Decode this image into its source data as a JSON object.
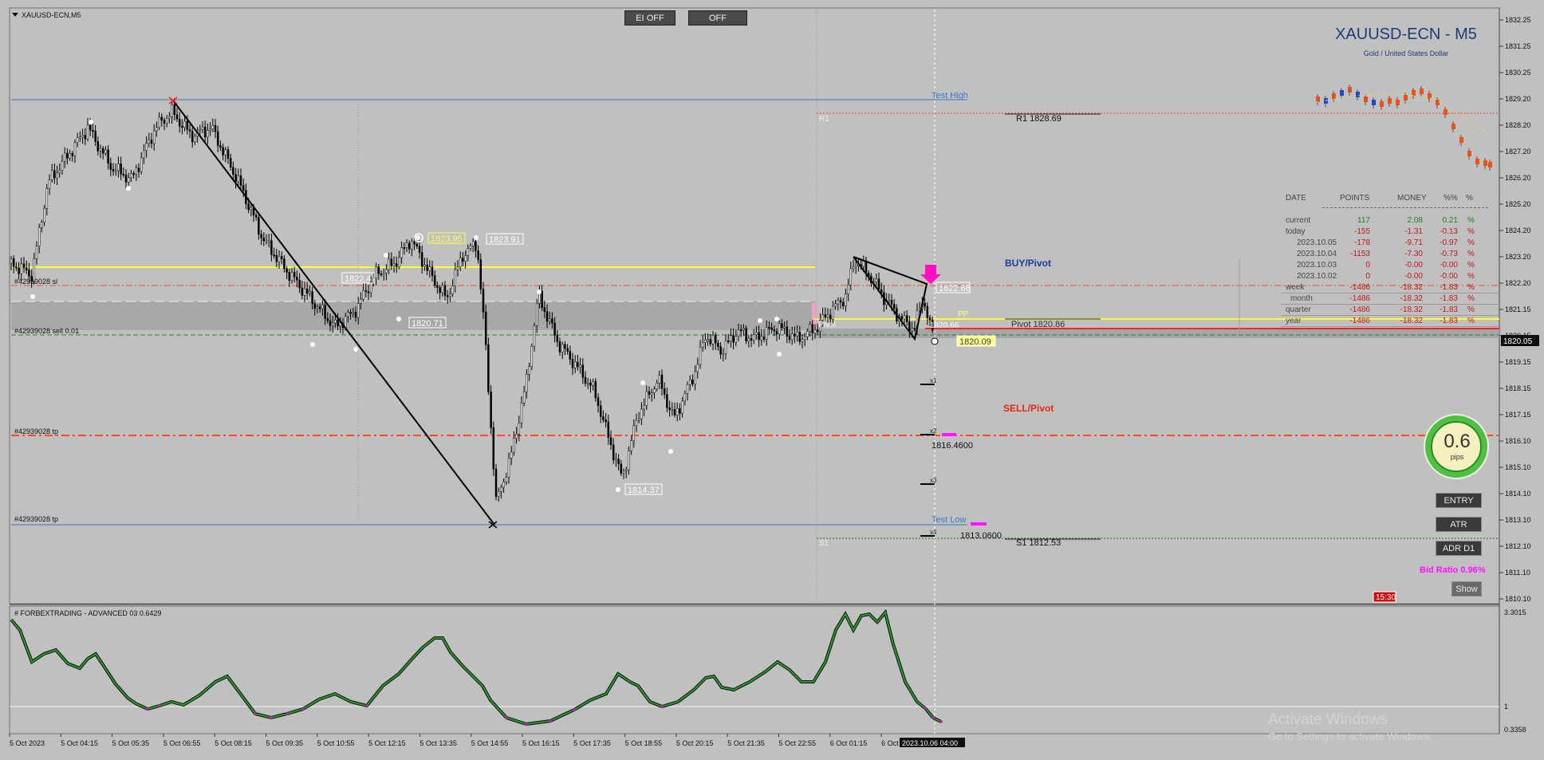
{
  "window": {
    "title": "XAUUSD-ECN,M5"
  },
  "symbol": {
    "name": "XAUUSD-ECN - M5",
    "description": "Gold / United States Dollar"
  },
  "buttons": {
    "ei_off": "EI OFF",
    "off": "OFF",
    "entry": "ENTRY",
    "atr": "ATR",
    "adr_d1": "ADR D1",
    "show": "Show"
  },
  "price_axis": {
    "ticks": [
      "1832.25",
      "1831.25",
      "1830.25",
      "1829.20",
      "1828.20",
      "1827.20",
      "1826.20",
      "1825.20",
      "1824.20",
      "1823.20",
      "1822.20",
      "1821.15",
      "1820.15",
      "1819.15",
      "1818.15",
      "1817.15",
      "1816.10",
      "1815.10",
      "1814.10",
      "1813.10",
      "1812.10",
      "1811.10",
      "1810.10"
    ],
    "current_price": "1820.05"
  },
  "indicator": {
    "title": "# FORBEXTRADING - ADVANCED 03 0.6429",
    "ticks": [
      "3.3015",
      "1",
      "0.3358"
    ]
  },
  "time_axis": [
    "5 Oct 2023",
    "5 Oct 04:15",
    "5 Oct 05:35",
    "5 Oct 06:55",
    "5 Oct 08:15",
    "5 Oct 09:35",
    "5 Oct 10:55",
    "5 Oct 12:15",
    "5 Oct 13:35",
    "5 Oct 14:55",
    "5 Oct 16:15",
    "5 Oct 17:35",
    "5 Oct 18:55",
    "5 Oct 20:15",
    "5 Oct 21:35",
    "5 Oct 22:55",
    "6 Oct 01:15",
    "6 Oct"
  ],
  "crosshair_time": "2023.10.06 04:00",
  "labels": {
    "test_high": "Test High",
    "test_low": "Test Low",
    "r1_short": "R1",
    "s1_short": "S1",
    "pivot_short": "Pivot",
    "pp": "PP",
    "r1": "R1 1828.69",
    "pivot": "Pivot 1820.86",
    "s1": "S1 1812.53",
    "buy_pivot": "BUY/Pivot",
    "sell_pivot": "SELL/Pivot",
    "order_sl": "#42939028 sl",
    "order_sell": "#42939028 sell 0.01",
    "order_tp1": "#42939028 tp",
    "order_tp2": "#42939028 tp",
    "lvl_1816": "1816.4600",
    "lvl_1813": "1813.0600",
    "bid_ratio": "Bid Ratio 0.96%",
    "clock": "15:30",
    "x1": "x1",
    "x2": "x2",
    "x3": "x3",
    "x4": "x4"
  },
  "price_tags": {
    "t1823_95": "1823.95",
    "t1823_91": "1823.91",
    "t1822_4x": "1822.4",
    "t1820_71": "1820.71",
    "t1814_37": "1814.37",
    "t1822_66": "1822.66",
    "t1820_66": "1820.66",
    "t1820_09": "1820.09"
  },
  "stats": {
    "headers": [
      "DATE",
      "POINTS",
      "MONEY",
      "%%",
      "%"
    ],
    "rows": [
      {
        "date": "current",
        "points": "117",
        "money": "2.08",
        "pct": "0.21",
        "sym": "%",
        "color": "#1a8a1a"
      },
      {
        "date": "today",
        "points": "-155",
        "money": "-1.31",
        "pct": "-0.13",
        "sym": "%",
        "color": "#c01818"
      },
      {
        "date": "2023.10.05",
        "points": "-178",
        "money": "-9.71",
        "pct": "-0.97",
        "sym": "%",
        "color": "#c01818"
      },
      {
        "date": "2023.10.04",
        "points": "-1153",
        "money": "-7.30",
        "pct": "-0.73",
        "sym": "%",
        "color": "#c01818"
      },
      {
        "date": "2023.10.03",
        "points": "0",
        "money": "-0.00",
        "pct": "-0.00",
        "sym": "%",
        "color": "#c01818"
      },
      {
        "date": "2023.10.02",
        "points": "0",
        "money": "-0.00",
        "pct": "-0.00",
        "sym": "%",
        "color": "#c01818"
      },
      {
        "date": "week",
        "points": "-1486",
        "money": "-18.32",
        "pct": "-1.83",
        "sym": "%",
        "color": "#c01818"
      },
      {
        "date": "month",
        "points": "-1486",
        "money": "-18.32",
        "pct": "-1.83",
        "sym": "%",
        "color": "#c01818"
      },
      {
        "date": "quarter",
        "points": "-1486",
        "money": "-18.32",
        "pct": "-1.83",
        "sym": "%",
        "color": "#c01818"
      },
      {
        "date": "year",
        "points": "-1486",
        "money": "-18.32",
        "pct": "-1.83",
        "sym": "%",
        "color": "#c01818"
      }
    ]
  },
  "gauge": {
    "value": "0.6",
    "unit": "pips"
  },
  "watermark": {
    "line1": "Activate Windows",
    "line2": "Go to Settings to activate Windows."
  },
  "colors": {
    "background": "#c0c0c0",
    "candles": "#000000",
    "support_red": "#ff3a00",
    "magenta": "#ff00ff",
    "title_blue": "#1c3c78"
  }
}
